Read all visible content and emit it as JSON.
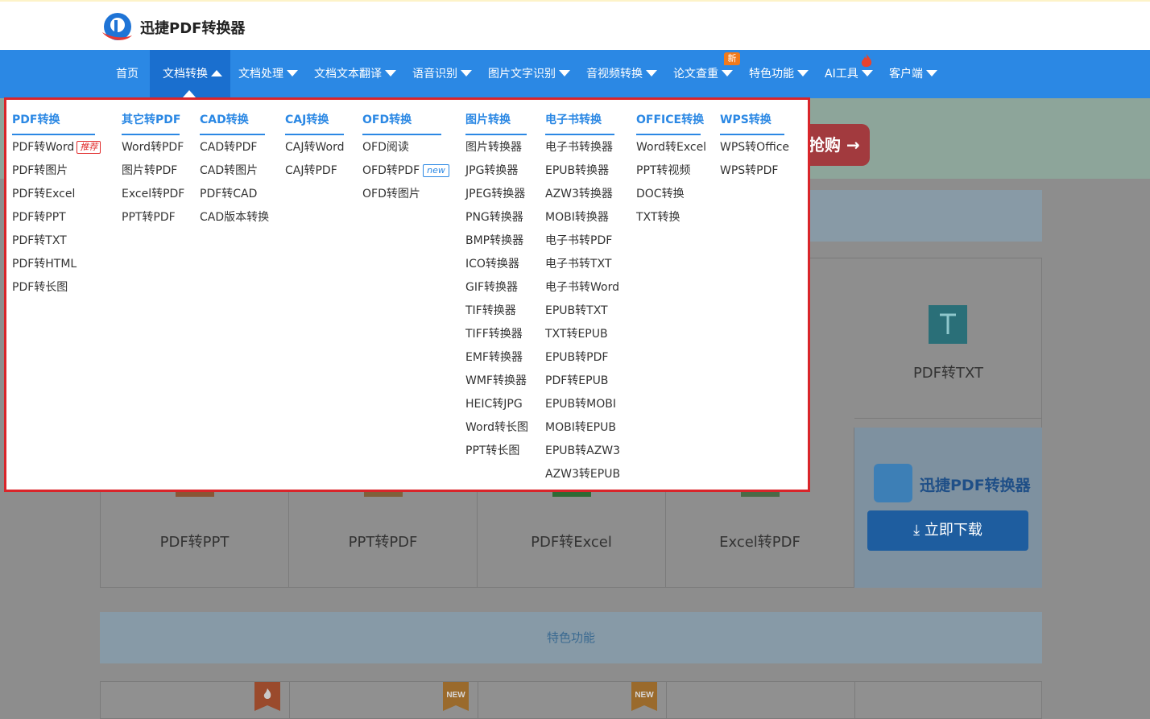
{
  "header": {
    "brand": "迅捷PDF转换器",
    "logo_icon": "xunjie-logo-icon"
  },
  "nav": {
    "items": [
      {
        "label": "首页"
      },
      {
        "label": "文档转换"
      },
      {
        "label": "文档处理"
      },
      {
        "label": "文档文本翻译"
      },
      {
        "label": "语音识别"
      },
      {
        "label": "图片文字识别"
      },
      {
        "label": "音视频转换"
      },
      {
        "label": "论文查重"
      },
      {
        "label": "特色功能"
      },
      {
        "label": "AI工具"
      },
      {
        "label": "客户端"
      }
    ],
    "new_badge": "新",
    "hot_icon": "fire-icon"
  },
  "dropdown": {
    "columns": [
      {
        "title": "PDF转换",
        "items": [
          "PDF转Word",
          "PDF转图片",
          "PDF转Excel",
          "PDF转PPT",
          "PDF转TXT",
          "PDF转HTML",
          "PDF转长图"
        ]
      },
      {
        "title": "其它转PDF",
        "items": [
          "Word转PDF",
          "图片转PDF",
          "Excel转PDF",
          "PPT转PDF"
        ]
      },
      {
        "title": "CAD转换",
        "items": [
          "CAD转PDF",
          "CAD转图片",
          "PDF转CAD",
          "CAD版本转换"
        ]
      },
      {
        "title": "CAJ转换",
        "items": [
          "CAJ转Word",
          "CAJ转PDF"
        ]
      },
      {
        "title": "OFD转换",
        "items": [
          "OFD阅读",
          "OFD转PDF",
          "OFD转图片"
        ]
      },
      {
        "title": "图片转换",
        "items": [
          "图片转换器",
          "JPG转换器",
          "JPEG转换器",
          "PNG转换器",
          "BMP转换器",
          "ICO转换器",
          "GIF转换器",
          "TIF转换器",
          "TIFF转换器",
          "EMF转换器",
          "WMF转换器",
          "HEIC转JPG",
          "Word转长图",
          "PPT转长图"
        ]
      },
      {
        "title": "电子书转换",
        "items": [
          "电子书转换器",
          "EPUB转换器",
          "AZW3转换器",
          "MOBI转换器",
          "电子书转PDF",
          "电子书转TXT",
          "电子书转Word",
          "EPUB转TXT",
          "TXT转EPUB",
          "EPUB转PDF",
          "PDF转EPUB",
          "EPUB转MOBI",
          "MOBI转EPUB",
          "EPUB转AZW3",
          "AZW3转EPUB"
        ]
      },
      {
        "title": "OFFICE转换",
        "items": [
          "Word转Excel",
          "PPT转视频",
          "DOC转换",
          "TXT转换"
        ]
      },
      {
        "title": "WPS转换",
        "items": [
          "WPS转Office",
          "WPS转PDF"
        ]
      }
    ],
    "hot_tag": "推荐",
    "new_tag": "new"
  },
  "background": {
    "banner_button": "抢购 →",
    "cells": [
      "PDF转TXT",
      "PDF转PPT",
      "PPT转PDF",
      "PDF转Excel",
      "Excel转PDF"
    ],
    "promo_title": "迅捷PDF转换器",
    "download_label": "立即下载",
    "feature_label": "特色功能",
    "ribbon_new": "NEW"
  },
  "colors": {
    "nav_blue": "#2b88e4",
    "dropdown_border": "#d9252a",
    "accent_text": "#2b88e4"
  }
}
